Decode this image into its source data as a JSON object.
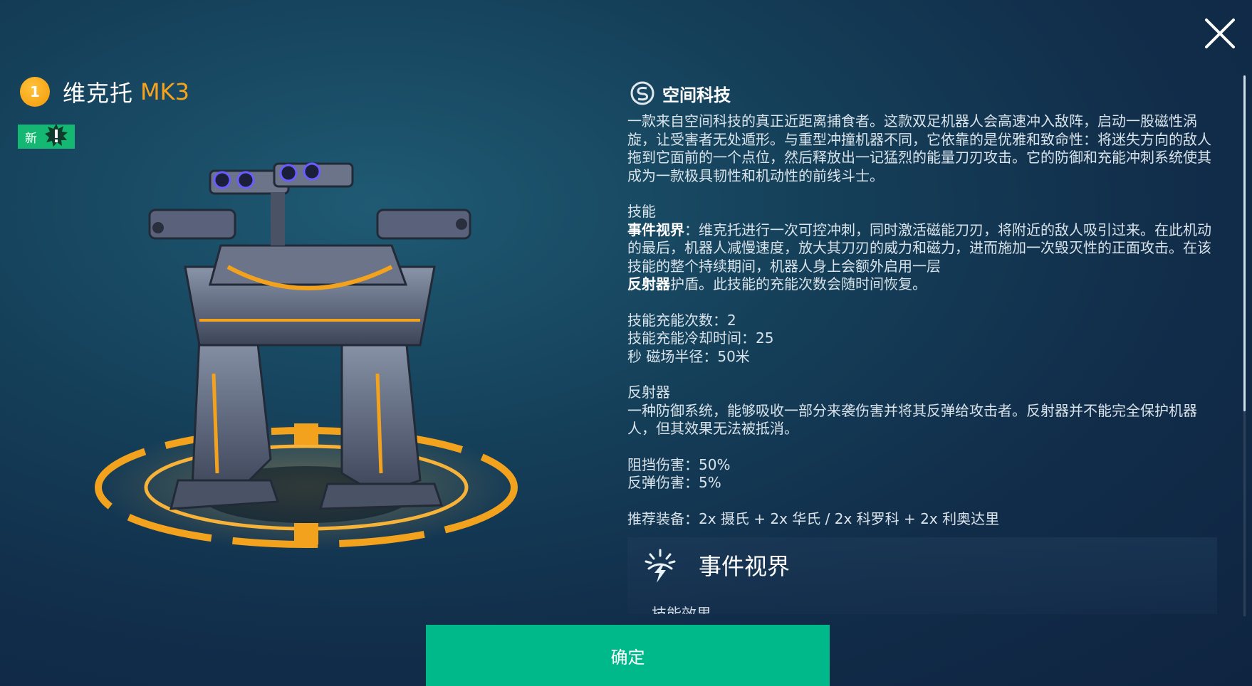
{
  "header": {
    "tier": "1",
    "name": "维克托",
    "mark": "MK3",
    "new_label": "新"
  },
  "manufacturer": {
    "name": "空间科技",
    "icon": "manufacturer-logo-icon"
  },
  "description": {
    "intro": "一款来自空间科技的真正近距离捕食者。这款双足机器人会高速冲入敌阵，启动一股磁性涡旋，让受害者无处遁形。与重型冲撞机器不同，它依靠的是优雅和致命性：将迷失方向的敌人拖到它面前的一个点位，然后释放出一记猛烈的能量刀刃攻击。它的防御和充能冲刺系统使其成为一款极具韧性和机动性的前线斗士。",
    "skill_header": "技能",
    "skill_name": "事件视界",
    "skill_text": "：维克托进行一次可控冲刺，同时激活磁能刀刃，将附近的敌人吸引过来。在此机动的最后，机器人减慢速度，放大其刀刃的威力和磁力，进而施加一次毁灭性的正面攻击。在该技能的整个持续期间，机器人身上会额外启用一层",
    "skill_reflector": "反射器",
    "skill_text2": "护盾。此技能的充能次数会随时间恢复。",
    "stat1": "技能充能次数：2",
    "stat2": "技能充能冷却时间：25",
    "stat3": "秒 磁场半径：50米",
    "reflector_header": "反射器",
    "reflector_text": "一种防御系统，能够吸收一部分来袭伤害并将其反弹给攻击者。反射器并不能完全保护机器人，但其效果无法被抵消。",
    "block": "阻挡伤害：50%",
    "reflect": "反弹伤害：5%",
    "recommended": "推荐装备：2x 摄氏 + 2x 华氏 / 2x 科罗科 + 2x 利奥达里"
  },
  "ability_card": {
    "title": "事件视界",
    "subtitle": "技能效果",
    "icon": "event-horizon-icon"
  },
  "confirm_label": "确定",
  "colors": {
    "accent_orange": "#f7a31c",
    "confirm_green": "#00b98a",
    "new_green": "#14b873"
  }
}
